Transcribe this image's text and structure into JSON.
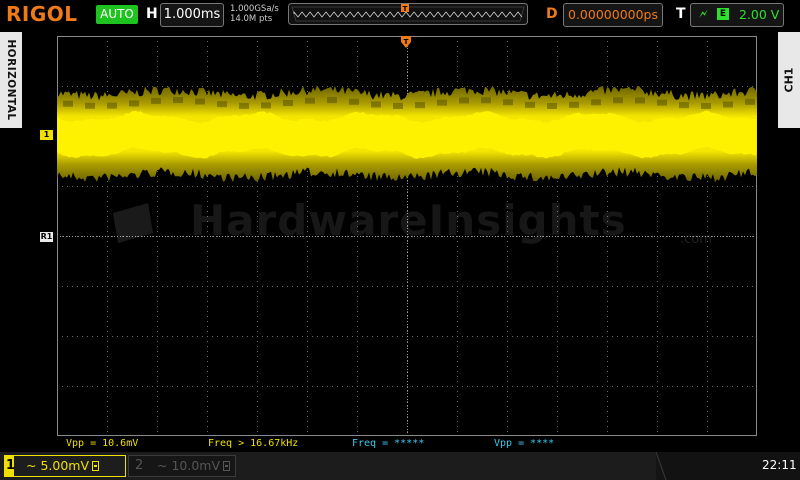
{
  "header": {
    "brand": "RIGOL",
    "run_mode": "AUTO",
    "horizontal_letter": "H",
    "timebase": "1.000ms",
    "sample_rate": "1.000GSa/s",
    "memory_depth": "14.0M pts",
    "delay_letter": "D",
    "delay": "0.00000000ps",
    "trigger_letter": "T",
    "trigger_slope_icon": "rising-edge-icon",
    "trigger_source_icon": "external-source-icon",
    "trigger_level": "2.00 V"
  },
  "side": {
    "left_tab": "HORIZONTAL",
    "right_tab": "CH1"
  },
  "markers": {
    "ch1": "1",
    "ref": "R1"
  },
  "watermark": {
    "text": "HardwareInsights",
    "suffix": ".com"
  },
  "measurements": [
    {
      "label": "Vpp = 10.6mV",
      "color": "#f0e000"
    },
    {
      "label": "Freq > 16.67kHz",
      "color": "#f0e000"
    },
    {
      "label": "Freq = *****",
      "color": "#3cc8f0"
    },
    {
      "label": "Vpp = ****",
      "color": "#3cc8f0"
    }
  ],
  "footer": {
    "ch1_number": "1",
    "ch1_scale": "~ 5.00mV",
    "ch2_number": "2",
    "ch2_scale": "~ 10.0mV",
    "clock": "22:11"
  },
  "colors": {
    "ch1": "#f0e000",
    "brand": "#f07a16",
    "trigger": "#2ee02e",
    "meas2": "#3cc8f0"
  }
}
